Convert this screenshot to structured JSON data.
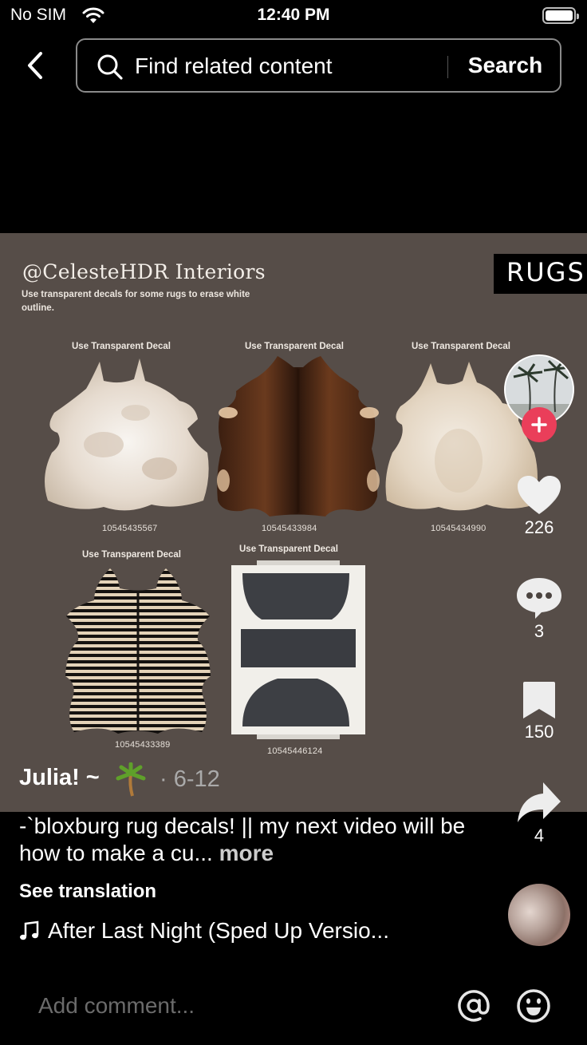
{
  "status_bar": {
    "carrier": "No SIM",
    "time": "12:40 PM",
    "wifi_icon": "wifi-icon",
    "battery_icon": "battery-full-icon"
  },
  "header": {
    "back_icon": "chevron-left-icon",
    "search_icon": "magnifier-icon",
    "search_placeholder": "Find related content",
    "search_button_label": "Search"
  },
  "video": {
    "brand_title": "@CelesteHDR Interiors",
    "brand_subtitle": "Use transparent decals for some rugs to erase white outline.",
    "tag": "RUGS",
    "rugs": [
      {
        "label": "Use Transparent Decal",
        "id": "10545435567",
        "kind": "white-beige cowhide"
      },
      {
        "label": "Use Transparent Decal",
        "id": "10545433984",
        "kind": "brown brindle cowhide"
      },
      {
        "label": "Use Transparent Decal",
        "id": "10545434990",
        "kind": "cream cowhide"
      },
      {
        "label": "Use Transparent Decal",
        "id": "10545433389",
        "kind": "zebra hide"
      },
      {
        "label": "Use Transparent Decal",
        "id": "10545446124",
        "kind": "white and charcoal striped rug"
      }
    ]
  },
  "actions": {
    "follow_icon": "plus-icon",
    "like_icon": "heart-icon",
    "likes": "226",
    "comment_icon": "comment-bubble-icon",
    "comments": "3",
    "save_icon": "bookmark-icon",
    "saves": "150",
    "share_icon": "share-arrow-icon",
    "shares": "4"
  },
  "post": {
    "author": "Julia! ~",
    "author_emoji": "palm-tree",
    "date": "· 6-12",
    "caption": "-`bloxburg rug decals! || my next video will be how to make a cu...",
    "more_label": "more",
    "see_translation": "See translation",
    "music_icon": "music-note-icon",
    "music_title": "After Last Night (Sped Up Versio..."
  },
  "comment_bar": {
    "placeholder": "Add comment...",
    "mention_icon": "at-sign-icon",
    "emoji_icon": "smiley-icon"
  },
  "colors": {
    "video_background": "#564d48",
    "follow_accent": "#ea3e5a",
    "background": "#000000"
  }
}
